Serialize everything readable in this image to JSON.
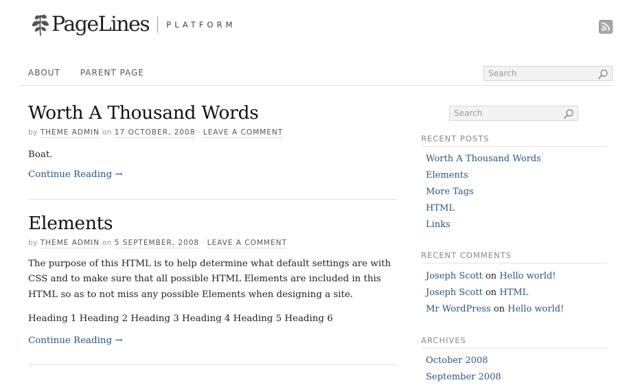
{
  "header": {
    "logo_text": "PageLines",
    "logo_tagline": "PLATFORM",
    "rss_icon": "rss-icon"
  },
  "nav": {
    "items": [
      "ABOUT",
      "PARENT PAGE"
    ],
    "search_placeholder": "Search"
  },
  "posts": [
    {
      "title": "Worth A Thousand Words",
      "by": "by",
      "author": "THEME ADMIN",
      "on": "on",
      "date": "17 OCTOBER, 2008",
      "sep": "·",
      "comment_link": "LEAVE A COMMENT",
      "paragraphs": [
        "Boat."
      ],
      "more": "Continue Reading →"
    },
    {
      "title": "Elements",
      "by": "by",
      "author": "THEME ADMIN",
      "on": "on",
      "date": "5 SEPTEMBER, 2008",
      "sep": "·",
      "comment_link": "LEAVE A COMMENT",
      "paragraphs": [
        "The purpose of this HTML is to help determine what default settings are with CSS and to make sure that all possible HTML Elements are included in this HTML so as to not miss any possible Elements when designing a site.",
        "Heading 1 Heading 2 Heading 3 Heading 4 Heading 5 Heading 6"
      ],
      "more": "Continue Reading →"
    }
  ],
  "sidebar": {
    "search_placeholder": "Search",
    "recent_posts": {
      "heading": "RECENT POSTS",
      "items": [
        "Worth A Thousand Words",
        "Elements",
        "More Tags",
        "HTML",
        "Links"
      ]
    },
    "recent_comments": {
      "heading": "RECENT COMMENTS",
      "items": [
        {
          "author": "Joseph Scott",
          "on": "on",
          "post": "Hello world!"
        },
        {
          "author": "Joseph Scott",
          "on": "on",
          "post": "HTML"
        },
        {
          "author": "Mr WordPress",
          "on": "on",
          "post": "Hello world!"
        }
      ]
    },
    "archives": {
      "heading": "ARCHIVES",
      "items": [
        "October 2008",
        "September 2008"
      ]
    }
  },
  "colors": {
    "link": "#2c5480",
    "meta": "#999999",
    "rule": "#e2e2e2"
  }
}
